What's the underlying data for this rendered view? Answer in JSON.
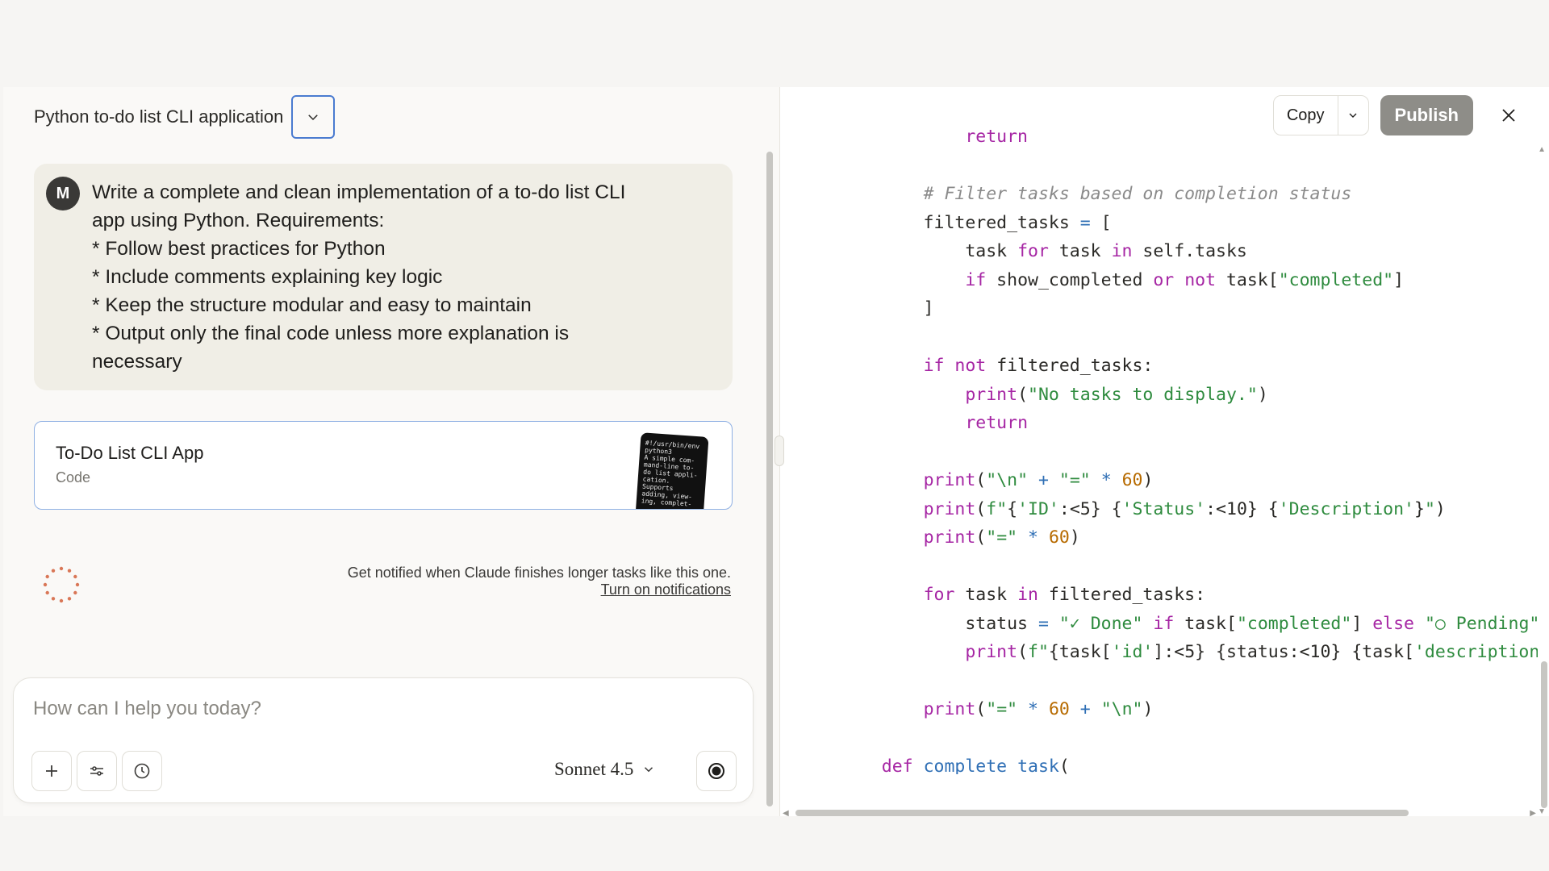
{
  "conversation": {
    "title": "Python to-do list CLI application"
  },
  "user_message": {
    "avatar_initial": "M",
    "lines": [
      "Write a complete and clean implementation of a to-do list CLI",
      "app using Python. Requirements:",
      "* Follow best practices for Python",
      "* Include comments explaining key logic",
      "* Keep the structure modular and easy to maintain",
      "* Output only the final code unless more explanation is",
      "necessary"
    ]
  },
  "artifact": {
    "title": "To-Do List CLI App",
    "subtitle": "Code",
    "thumb_lines": [
      "#!/usr/bin/env",
      "python3",
      "",
      "A simple com-",
      "mand-line to-",
      "do list appli-",
      "cation.",
      "Supports",
      "adding, view-",
      "ing, complet-"
    ]
  },
  "notification": {
    "text": "Get notified when Claude finishes longer tasks like this one.",
    "link": "Turn on notifications"
  },
  "composer": {
    "placeholder": "How can I help you today?",
    "model": "Sonnet 4.5"
  },
  "code_panel": {
    "copy_label": "Copy",
    "publish_label": "Publish"
  },
  "colors": {
    "accent_border": "#4a7bd0",
    "publish_bg": "#8e8d88",
    "spinner": "#d97757"
  }
}
